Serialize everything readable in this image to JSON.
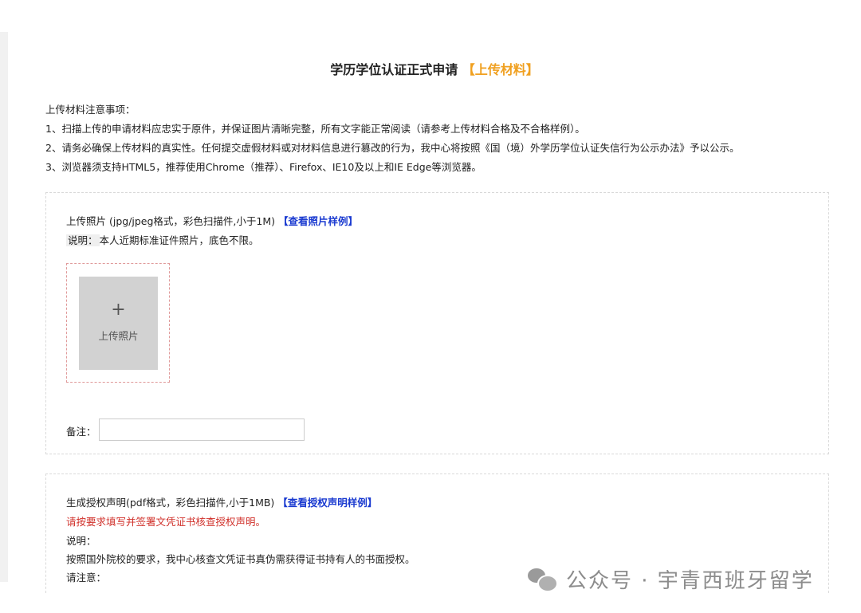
{
  "page": {
    "title": "学历学位认证正式申请",
    "title_accent": "【上传材料】"
  },
  "notices": {
    "heading": "上传材料注意事项：",
    "items": [
      "1、扫描上传的申请材料应忠实于原件，并保证图片清晰完整，所有文字能正常阅读（请参考上传材料合格及不合格样例）。",
      "2、请务必确保上传材料的真实性。任何提交虚假材料或对材料信息进行篡改的行为，我中心将按照《国（境）外学历学位认证失信行为公示办法》予以公示。",
      "3、浏览器须支持HTML5，推荐使用Chrome（推荐）、Firefox、IE10及以上和IE Edge等浏览器。"
    ]
  },
  "photo_section": {
    "title": "上传照片 (jpg/jpeg格式，彩色扫描件,小于1M)",
    "sample_link": "【查看照片样例】",
    "desc_label": "说明：",
    "desc_text": "本人近期标准证件照片，底色不限。",
    "upload_plus": "+",
    "upload_label": "上传照片",
    "remark_label": "备注：",
    "remark_value": ""
  },
  "auth_section": {
    "title": "生成授权声明(pdf格式，彩色扫描件,小于1MB)",
    "sample_link": "【查看授权声明样例】",
    "warning": "请按要求填写并签署文凭证书核查授权声明。",
    "desc_label": "说明：",
    "desc_text": "按照国外院校的要求，我中心核查文凭证书真伪需获得证书持有人的书面授权。",
    "attention_label": "请注意："
  },
  "watermark": {
    "icon": "wechat-icon",
    "text": "公众号 · 宇青西班牙留学"
  },
  "colors": {
    "accent": "#f0a020",
    "link": "#1a3ad0",
    "warning": "#d0302a"
  }
}
